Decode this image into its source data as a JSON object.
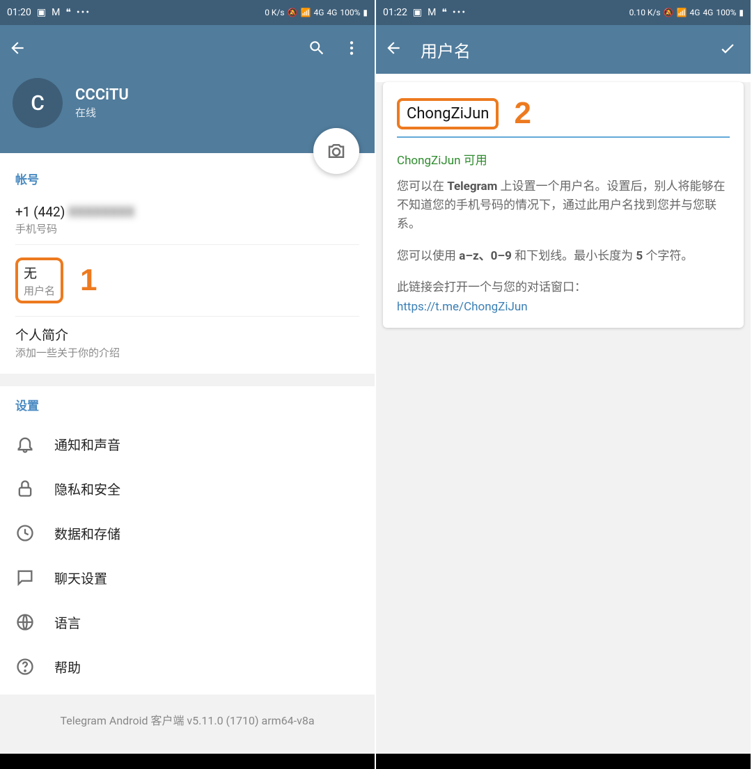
{
  "left": {
    "status": {
      "time": "01:20",
      "speed": "0 K/s",
      "battery": "100%"
    },
    "profile": {
      "initial": "C",
      "name": "CCCiTU",
      "status": "在线"
    },
    "account": {
      "section_title": "帐号",
      "phone": "+1 (442)",
      "phone_label": "手机号码",
      "username_value": "无",
      "username_label": "用户名",
      "bio_title": "个人简介",
      "bio_hint": "添加一些关于你的介绍"
    },
    "settings": {
      "section_title": "设置",
      "items": [
        {
          "icon": "bell",
          "label": "通知和声音"
        },
        {
          "icon": "lock",
          "label": "隐私和安全"
        },
        {
          "icon": "clock",
          "label": "数据和存储"
        },
        {
          "icon": "chat",
          "label": "聊天设置"
        },
        {
          "icon": "globe",
          "label": "语言"
        },
        {
          "icon": "help",
          "label": "帮助"
        }
      ]
    },
    "version": "Telegram Android 客户端 v5.11.0 (1710) arm64-v8a",
    "callout": "1"
  },
  "right": {
    "status": {
      "time": "01:22",
      "speed": "0.10 K/s",
      "battery": "100%"
    },
    "title": "用户名",
    "input": "ChongZiJun",
    "status_ok": "ChongZiJun 可用",
    "help1_pre": "您可以在 ",
    "help1_bold": "Telegram",
    "help1_post": " 上设置一个用户名。设置后，别人将能够在不知道您的手机号码的情况下，通过此用户名找到您并与您联系。",
    "help2_a": "您可以使用 ",
    "help2_b": "a–z、0–9",
    "help2_c": " 和下划线。最小长度为 ",
    "help2_d": "5",
    "help2_e": " 个字符。",
    "help3": "此链接会打开一个与您的对话窗口：",
    "link": "https://t.me/ChongZiJun",
    "callout": "2"
  }
}
